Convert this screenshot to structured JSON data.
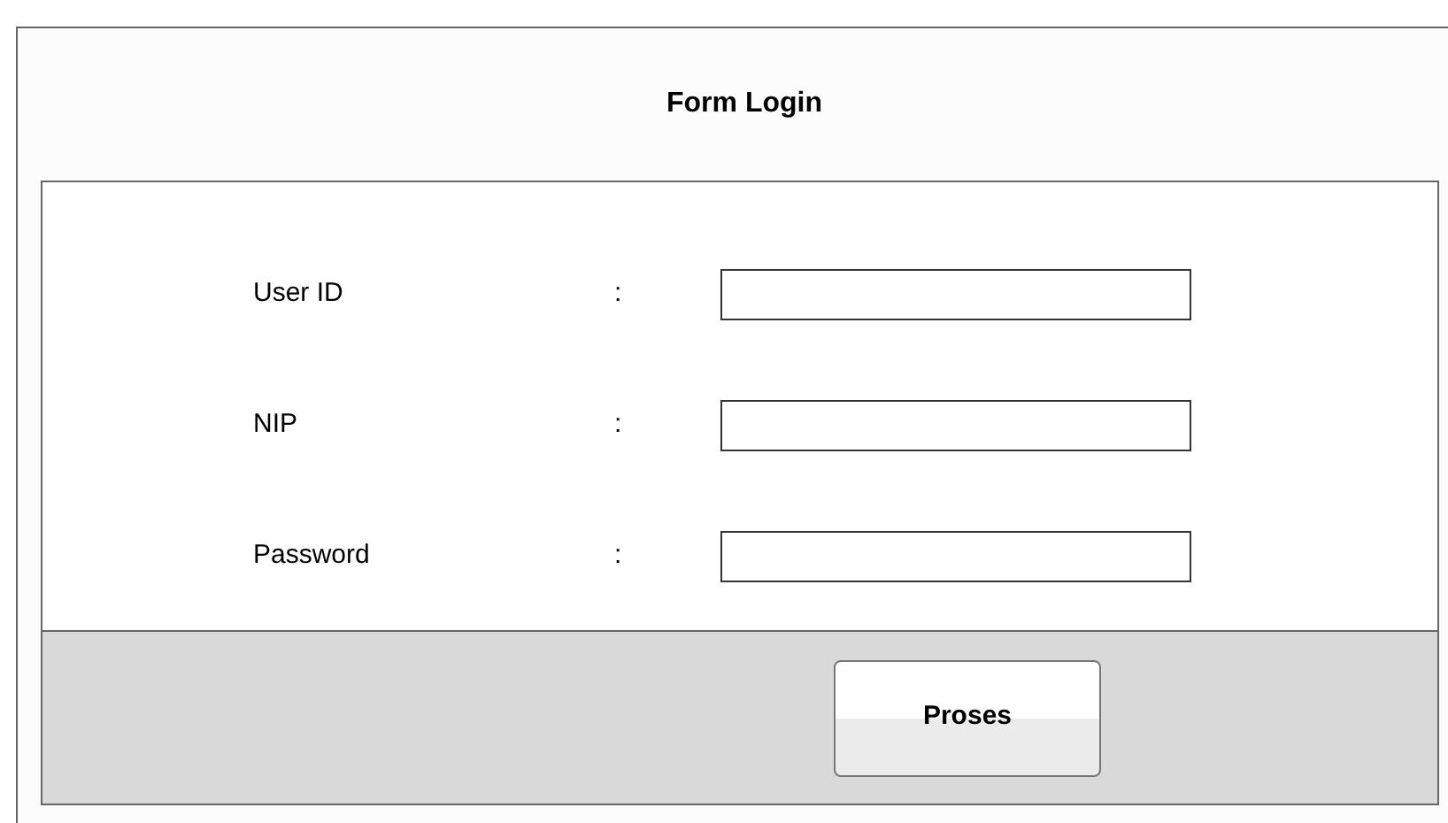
{
  "title": "Form Login",
  "fields": [
    {
      "label": "User ID",
      "separator": ":"
    },
    {
      "label": "NIP",
      "separator": ":"
    },
    {
      "label": "Password",
      "separator": ":"
    }
  ],
  "button": "Proses"
}
